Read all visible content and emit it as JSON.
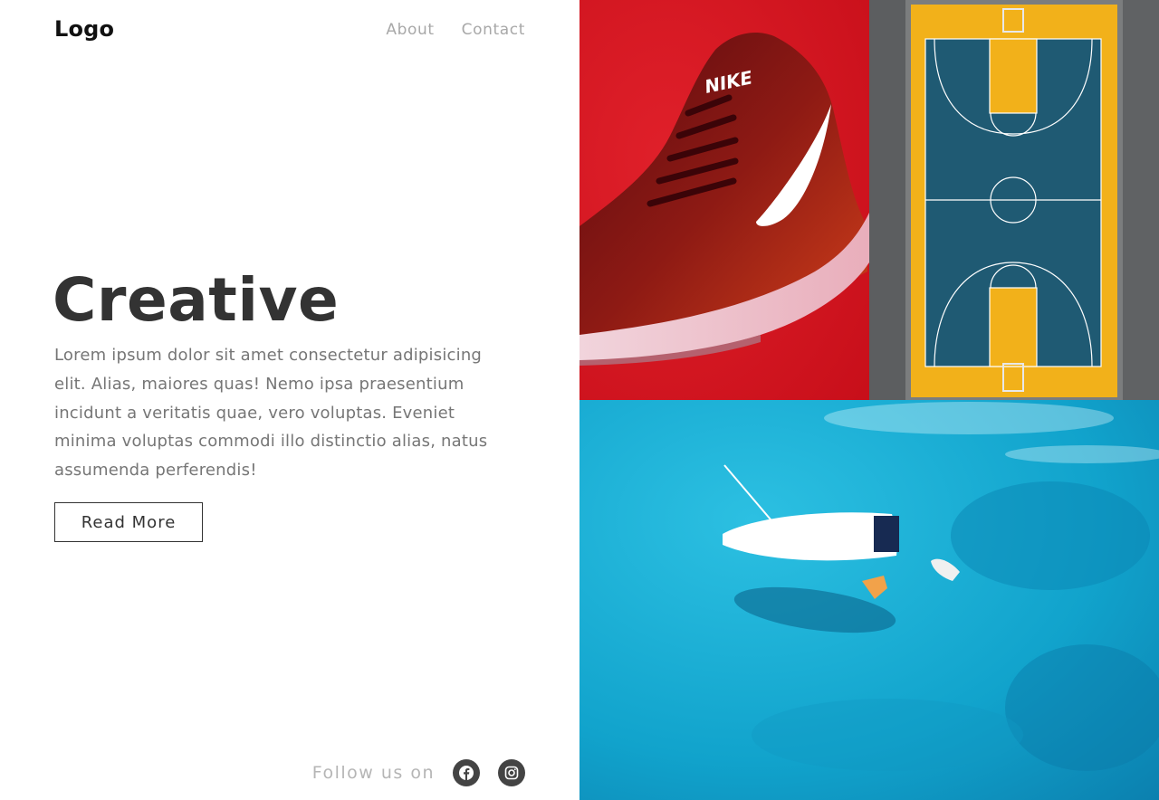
{
  "header": {
    "logo": "Logo",
    "nav": [
      {
        "label": "About"
      },
      {
        "label": "Contact"
      }
    ]
  },
  "hero": {
    "title": "Creative",
    "text": "Lorem ipsum dolor sit amet consectetur adipisicing elit. Alias, maiores quas! Nemo ipsa praesentium incidunt a veritatis quae, vero voluptas. Eveniet minima voluptas commodi illo distinctio alias, natus assumenda perferendis!",
    "button_label": "Read More"
  },
  "footer": {
    "follow_label": "Follow us on",
    "social": [
      {
        "icon": "facebook-icon"
      },
      {
        "icon": "instagram-icon"
      }
    ]
  },
  "gallery": {
    "images": [
      {
        "name": "sneaker-photo",
        "shoe_brand_text": "NIKE"
      },
      {
        "name": "basketball-court-photo"
      },
      {
        "name": "sailboat-sea-photo"
      }
    ]
  },
  "colors": {
    "text_dark": "#333333",
    "text_muted": "#767676",
    "nav_text": "#a8a8a8",
    "shoe_bg": "#d4141e",
    "court_blue": "#1f5a73",
    "court_yellow": "#f2b11a",
    "sea_blue": "#14a9cf"
  }
}
